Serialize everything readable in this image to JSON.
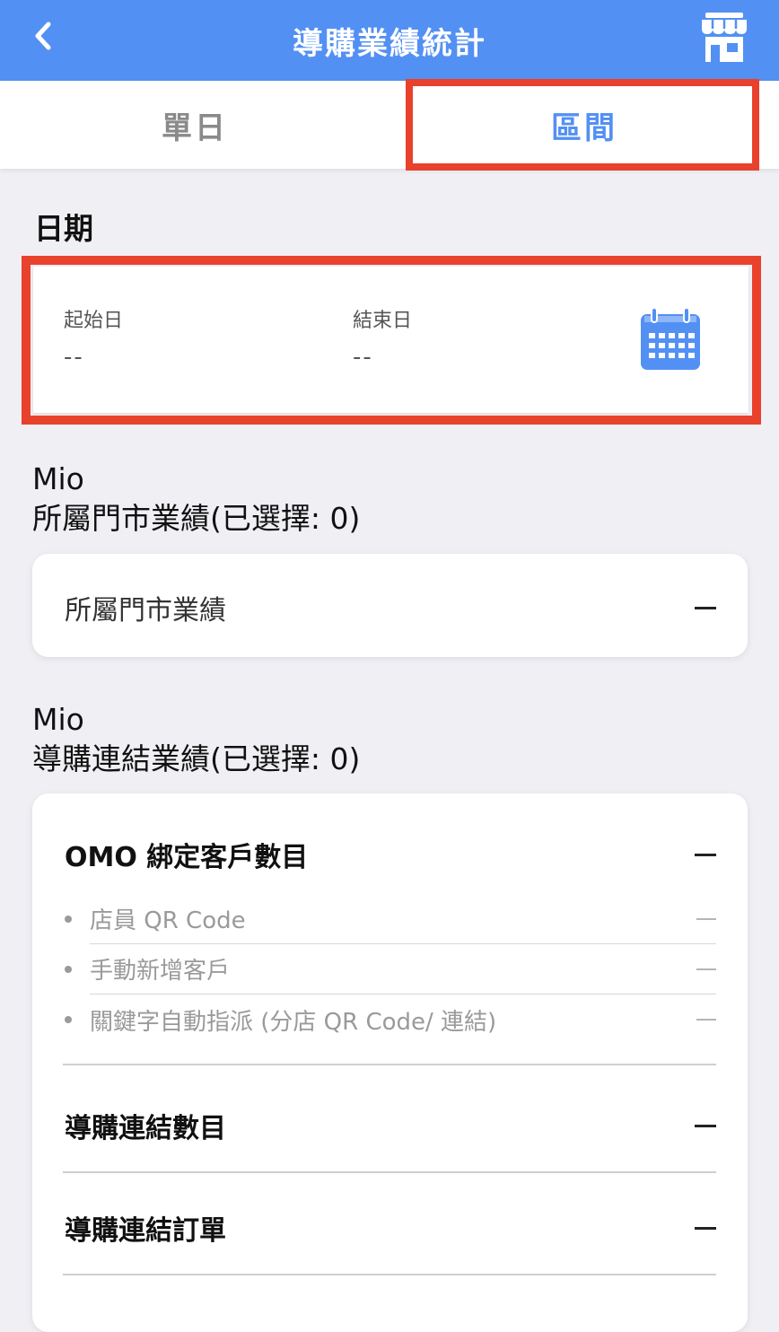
{
  "header": {
    "title": "導購業績統計",
    "back_icon": "chevron-left-icon",
    "store_icon": "storefront-icon"
  },
  "tabs": [
    {
      "label": "單日",
      "active": false
    },
    {
      "label": "區間",
      "active": true
    }
  ],
  "date_section": {
    "label": "日期",
    "start_label": "起始日",
    "start_value": "--",
    "end_label": "結束日",
    "end_value": "--",
    "calendar_icon": "calendar-icon"
  },
  "store_section": {
    "user": "Mio",
    "heading": "所屬門市業績(已選擇: 0)",
    "card_label": "所屬門市業績"
  },
  "link_section": {
    "user": "Mio",
    "heading": "導購連結業績(已選擇: 0)",
    "omo_label": "OMO 綁定客戶數目",
    "omo_items": [
      {
        "label": "店員 QR Code"
      },
      {
        "label": "手動新增客戶"
      },
      {
        "label": "關鍵字自動指派 (分店 QR Code/ 連結)"
      }
    ],
    "link_count_label": "導購連結數目",
    "link_orders_label": "導購連結訂單"
  },
  "colors": {
    "primary": "#5390f3",
    "highlight": "#e8412c",
    "background": "#f0eff4"
  }
}
